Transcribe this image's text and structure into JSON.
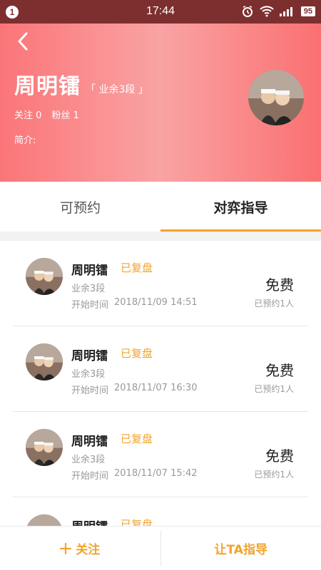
{
  "status_bar": {
    "notification_count": "1",
    "time": "17:44",
    "battery": "95"
  },
  "profile": {
    "name": "周明镭",
    "rank": "「 业余3段 」",
    "follow_label": "关注 0",
    "fans_label": "粉丝 1",
    "bio_label": "简介:"
  },
  "tabs": [
    {
      "label": "可预约"
    },
    {
      "label": "对弈指导"
    }
  ],
  "items": [
    {
      "name": "周明镭",
      "status": "已复盘",
      "level": "业余3段",
      "start_label": "开始时间",
      "start_time": "2018/11/09 14:51",
      "price": "免费",
      "booked": "已预约1人"
    },
    {
      "name": "周明镭",
      "status": "已复盘",
      "level": "业余3段",
      "start_label": "开始时间",
      "start_time": "2018/11/07 16:30",
      "price": "免费",
      "booked": "已预约1人"
    },
    {
      "name": "周明镭",
      "status": "已复盘",
      "level": "业余3段",
      "start_label": "开始时间",
      "start_time": "2018/11/07 15:42",
      "price": "免费",
      "booked": "已预约1人"
    },
    {
      "name": "周明镭",
      "status": "已复盘",
      "level": "",
      "start_label": "",
      "start_time": "",
      "price": "",
      "booked": ""
    }
  ],
  "bottom": {
    "follow_button": "关注",
    "guide_button": "让TA指导"
  },
  "colors": {
    "accent": "#f2a32b",
    "header_start": "#fb7578",
    "statusbar": "#7d2f30"
  },
  "icons": {
    "back": "chevron-left-icon",
    "plus": "plus-icon"
  }
}
